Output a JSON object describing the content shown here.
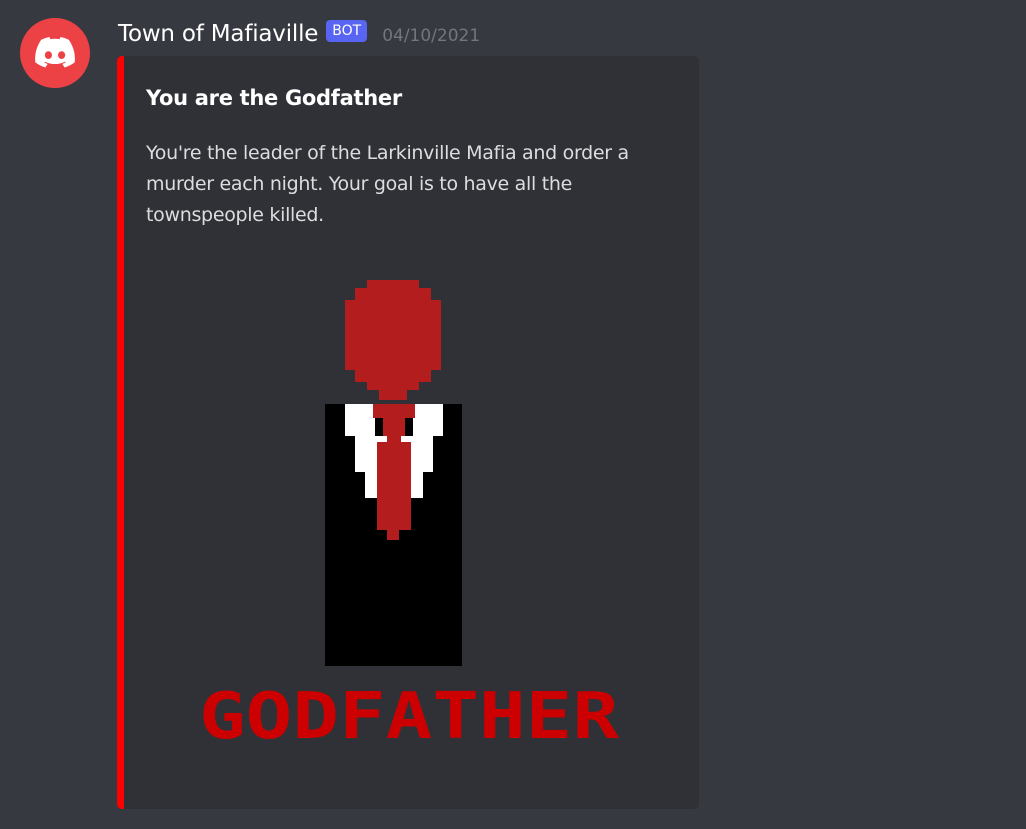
{
  "message": {
    "author": {
      "name": "Town of Mafiaville",
      "tag": "BOT",
      "avatar_icon": "discord-logo-icon",
      "avatar_color": "#ed4245"
    },
    "timestamp": "04/10/2021",
    "embed": {
      "color": "#ff0000",
      "title": "You are the Godfather",
      "description": "You're the leader of the Larkinville Mafia and order a murder each night. Your goal is to have all the townspeople killed.",
      "image": {
        "caption": "GODFATHER",
        "figure": "pixel-art-godfather-figure",
        "caption_color": "#cc0000",
        "head_color": "#b31d1d",
        "suit_color": "#000000",
        "shirt_color": "#ffffff"
      }
    }
  }
}
